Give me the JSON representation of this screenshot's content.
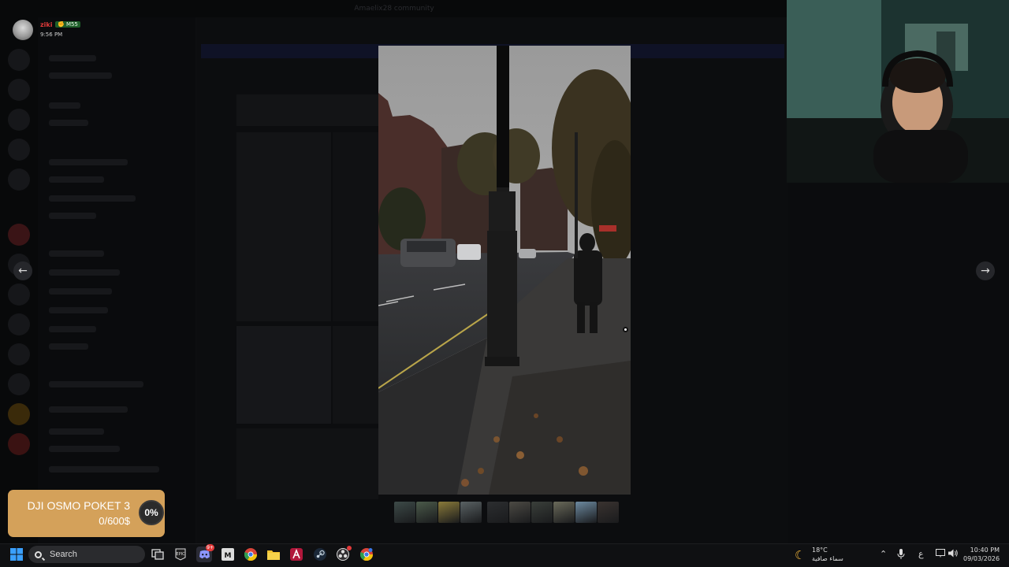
{
  "window": {
    "title": "Amaelix28 community"
  },
  "user_card": {
    "name": "ziki",
    "badge": "✊ M55",
    "time": "9:56 PM"
  },
  "viewer": {
    "prev_label": "←",
    "next_label": "→",
    "thumbnail_count": 10
  },
  "donation_goal": {
    "title": "DJI OSMO POKET 3",
    "amount": "0/600$",
    "percent": "0%",
    "progress": 0
  },
  "taskbar": {
    "search_placeholder": "Search",
    "weather_temp": "18°C",
    "weather_desc": "سماء صافية",
    "input_lang": "ع",
    "time": "10:40 PM",
    "date": "09/03/2026",
    "discord_badge": "9+",
    "icons": [
      "windows-start-icon",
      "search-icon",
      "task-view-icon",
      "epic-games-icon",
      "discord-icon",
      "app-icon",
      "chrome-icon",
      "file-explorer-icon",
      "red-app-icon",
      "steam-icon",
      "obs-icon",
      "chrome-profile-icon"
    ]
  },
  "colors": {
    "goal_bg": "#d4a15a",
    "accent_red": "#e23a3a",
    "taskbar_bg": "#0f1012"
  }
}
